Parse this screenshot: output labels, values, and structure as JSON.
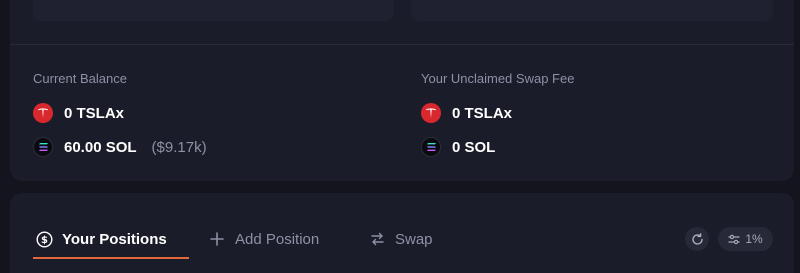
{
  "balance": {
    "title": "Current Balance",
    "tsla": {
      "amount": "0 TSLAx",
      "icon": "tesla-icon"
    },
    "sol": {
      "amount": "60.00 SOL",
      "usd": "($9.17k)",
      "icon": "solana-icon"
    }
  },
  "swap_fee": {
    "title": "Your Unclaimed Swap Fee",
    "tsla": {
      "amount": "0 TSLAx",
      "icon": "tesla-icon"
    },
    "sol": {
      "amount": "0 SOL",
      "icon": "solana-icon"
    }
  },
  "tabs": [
    {
      "label": "Your Positions",
      "icon": "dollar-circle-icon",
      "active": true
    },
    {
      "label": "Add Position",
      "icon": "plus-icon",
      "active": false
    },
    {
      "label": "Swap",
      "icon": "swap-arrows-icon",
      "active": false
    }
  ],
  "toolbar": {
    "refresh_icon": "refresh-icon",
    "slippage": "1%",
    "slippage_icon": "sliders-icon"
  },
  "colors": {
    "background": "#13141d",
    "panel": "#1b1c29",
    "muted_text": "#8e90a5",
    "accent": "#e2683c",
    "tesla_red": "#d8282d"
  }
}
